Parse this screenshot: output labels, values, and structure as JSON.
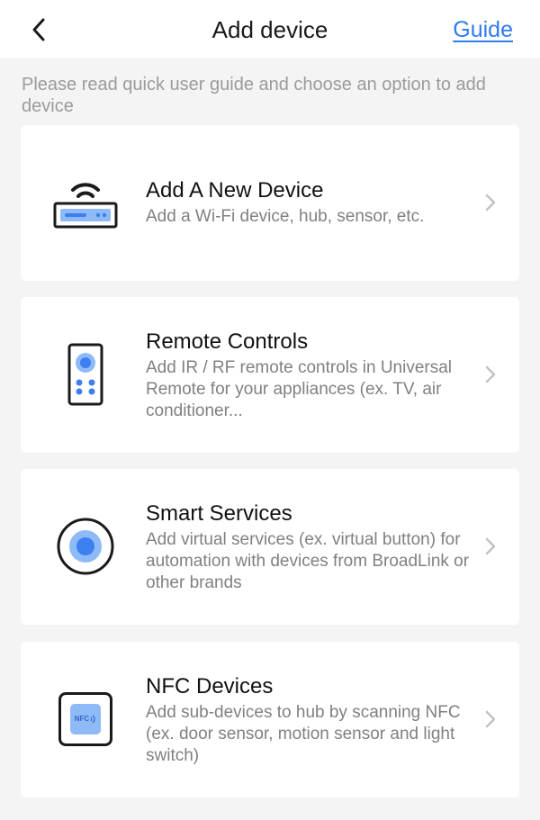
{
  "header": {
    "title": "Add device",
    "back_icon": "chevron-left-icon",
    "guide_label": "Guide",
    "guide_color": "#2f7bf0"
  },
  "intro_text": "Please read quick user guide and choose an option to add device",
  "options": [
    {
      "title": "Add A New Device",
      "description": "Add a Wi-Fi device, hub, sensor, etc.",
      "icon": "wifi-router-icon"
    },
    {
      "title": "Remote Controls",
      "description": "Add IR / RF remote controls in Universal Remote for your appliances (ex. TV, air conditioner...",
      "icon": "remote-control-icon"
    },
    {
      "title": "Smart Services",
      "description": "Add virtual services (ex. virtual button) for automation with devices from BroadLink or other brands",
      "icon": "smart-service-button-icon"
    },
    {
      "title": "NFC Devices",
      "description": "Add sub-devices to hub by scanning NFC (ex. door sensor, motion sensor and light switch)",
      "icon": "nfc-tag-icon",
      "icon_label": "NFC"
    }
  ],
  "colors": {
    "accent_blue": "#3d7ff0",
    "light_blue": "#8fbaf8",
    "icon_stroke": "#1a1a1a",
    "background": "#f4f4f4"
  }
}
